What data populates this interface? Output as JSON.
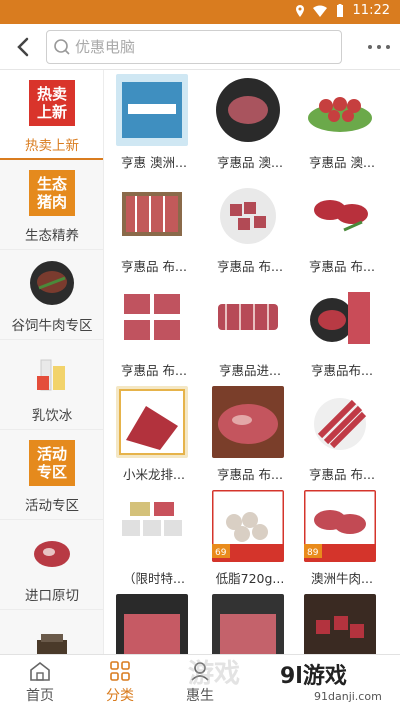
{
  "status_bar": {
    "time": "11:22"
  },
  "header": {
    "search_placeholder": "优惠电脑"
  },
  "sidebar": {
    "items": [
      {
        "label": "热卖上新",
        "tile": "热卖\n上新",
        "active": true
      },
      {
        "label": "生态精养",
        "tile": "生态\n猪肉"
      },
      {
        "label": "谷饲牛肉专区"
      },
      {
        "label": "乳饮冰"
      },
      {
        "label": "活动专区",
        "tile": "活动\n专区"
      },
      {
        "label": "进口原切"
      },
      {
        "label": ""
      }
    ]
  },
  "products": [
    {
      "name": "亨惠 澳洲..."
    },
    {
      "name": "亨惠品 澳..."
    },
    {
      "name": "亨惠品 澳..."
    },
    {
      "name": "亨惠品 布..."
    },
    {
      "name": "亨惠品 布..."
    },
    {
      "name": "亨惠品 布..."
    },
    {
      "name": "亨惠品 布..."
    },
    {
      "name": "亨惠品进..."
    },
    {
      "name": "亨惠品布..."
    },
    {
      "name": "小米龙排..."
    },
    {
      "name": "亨惠品 布..."
    },
    {
      "name": "亨惠品 布..."
    },
    {
      "name": "（限时特..."
    },
    {
      "name": "低脂720g..."
    },
    {
      "name": "澳洲牛肉..."
    },
    {
      "name": ""
    },
    {
      "name": ""
    },
    {
      "name": ""
    }
  ],
  "price_tags": {
    "p13": "69",
    "p14": "89"
  },
  "tabbar": {
    "tabs": [
      {
        "label": "首页"
      },
      {
        "label": "分类",
        "active": true
      },
      {
        "label": "惠生"
      }
    ]
  },
  "watermark": {
    "brand": "9l游戏",
    "site": "91danji.com"
  },
  "colors": {
    "accent": "#d97c1f",
    "hot_tile": "#d9342b",
    "tile_orange": "#e58a1d",
    "meat": "#b83a44"
  }
}
